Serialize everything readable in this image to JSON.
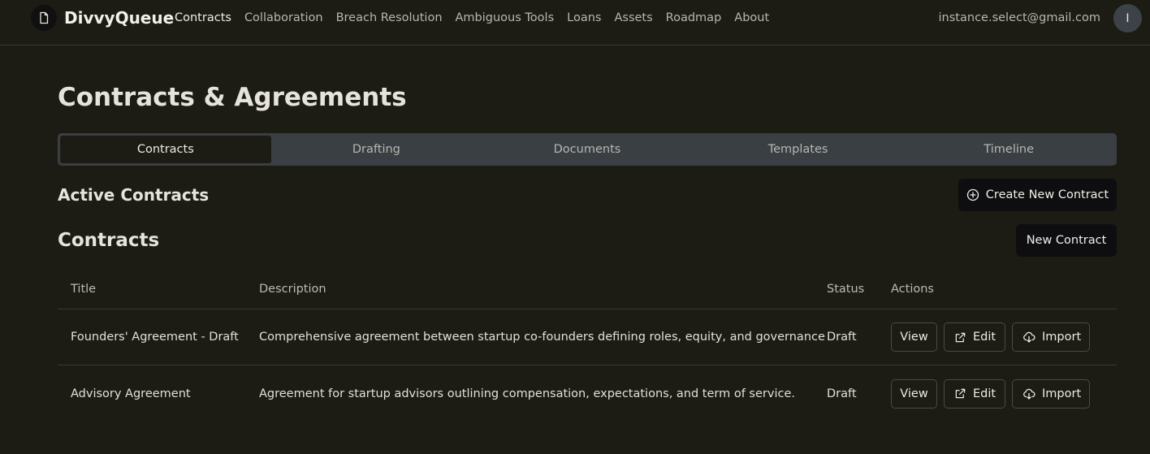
{
  "app": {
    "brand": "DivvyQueue",
    "user_email": "instance.select@gmail.com",
    "avatar_initial": "I"
  },
  "nav": [
    {
      "label": "Contracts",
      "active": true
    },
    {
      "label": "Collaboration"
    },
    {
      "label": "Breach Resolution"
    },
    {
      "label": "Ambiguous Tools"
    },
    {
      "label": "Loans"
    },
    {
      "label": "Assets"
    },
    {
      "label": "Roadmap"
    },
    {
      "label": "About"
    }
  ],
  "page": {
    "title": "Contracts & Agreements"
  },
  "tabs": [
    {
      "label": "Contracts",
      "active": true
    },
    {
      "label": "Drafting"
    },
    {
      "label": "Documents"
    },
    {
      "label": "Templates"
    },
    {
      "label": "Timeline"
    }
  ],
  "active_contracts": {
    "heading": "Active Contracts",
    "create_button": "Create New Contract"
  },
  "contracts": {
    "heading": "Contracts",
    "new_button": "New Contract",
    "columns": [
      "Title",
      "Description",
      "Status",
      "Actions"
    ],
    "rows": [
      {
        "title": "Founders' Agreement - Draft",
        "description": "Comprehensive agreement between startup co-founders defining roles, equity, and governance",
        "status": "Draft",
        "actions": [
          "View",
          "Edit",
          "Import"
        ]
      },
      {
        "title": "Advisory Agreement",
        "description": "Agreement for startup advisors outlining compensation, expectations, and term of service.",
        "status": "Draft",
        "actions": [
          "View",
          "Edit",
          "Import"
        ]
      }
    ]
  }
}
